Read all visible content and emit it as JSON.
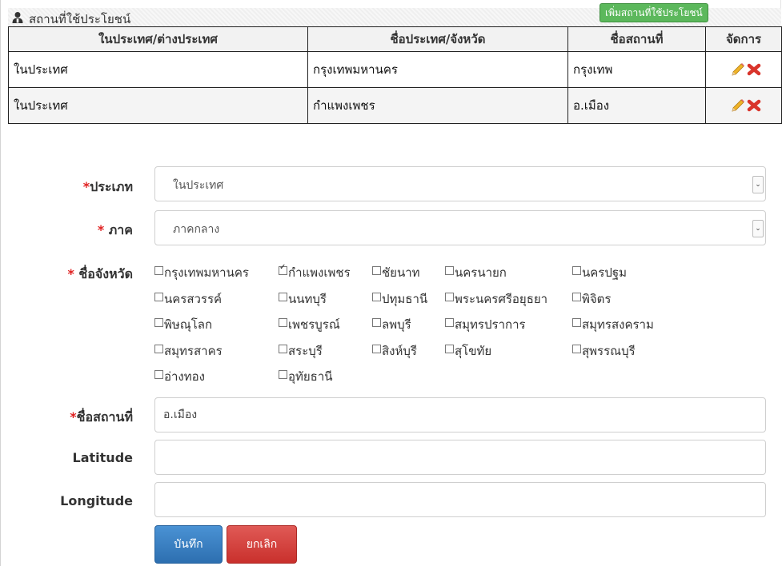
{
  "header": {
    "icon": "user-pin-icon",
    "title": "สถานที่ใช้ประโยชน์",
    "add_button": "เพิ่มสถานที่ใช้ประโยชน์"
  },
  "table": {
    "columns": [
      "ในประเทศ/ต่างประเทศ",
      "ชื่อประเทศ/จังหวัด",
      "ชื่อสถานที่",
      "จัดการ"
    ],
    "rows": [
      {
        "scope": "ในประเทศ",
        "province": "กรุงเทพมหานคร",
        "place": "กรุงเทพ"
      },
      {
        "scope": "ในประเทศ",
        "province": "กำแพงเพชร",
        "place": "อ.เมือง"
      }
    ],
    "action_icons": [
      "edit-pencil-icon",
      "delete-x-icon"
    ]
  },
  "form": {
    "required_mark": "*",
    "type_label": "ประเภท",
    "type_value": "ในประเทศ",
    "region_label": " ภาค",
    "region_value": "ภาคกลาง",
    "province_label": " ชื่อจังหวัด",
    "provinces": [
      {
        "name": "กรุงเทพมหานคร",
        "checked": false
      },
      {
        "name": "กำแพงเพชร",
        "checked": true
      },
      {
        "name": "ชัยนาท",
        "checked": false
      },
      {
        "name": "นครนายก",
        "checked": false
      },
      {
        "name": "นครปฐม",
        "checked": false
      },
      {
        "name": "นครสวรรค์",
        "checked": false
      },
      {
        "name": "นนทบุรี",
        "checked": false
      },
      {
        "name": "ปทุมธานี",
        "checked": false
      },
      {
        "name": "พระนครศรีอยุธยา",
        "checked": false
      },
      {
        "name": "พิจิตร",
        "checked": false
      },
      {
        "name": "พิษณุโลก",
        "checked": false
      },
      {
        "name": "เพชรบูรณ์",
        "checked": false
      },
      {
        "name": "ลพบุรี",
        "checked": false
      },
      {
        "name": "สมุทรปราการ",
        "checked": false
      },
      {
        "name": "สมุทรสงคราม",
        "checked": false
      },
      {
        "name": "สมุทรสาคร",
        "checked": false
      },
      {
        "name": "สระบุรี",
        "checked": false
      },
      {
        "name": "สิงห์บุรี",
        "checked": false
      },
      {
        "name": "สุโขทัย",
        "checked": false
      },
      {
        "name": "สุพรรณบุรี",
        "checked": false
      },
      {
        "name": "อ่างทอง",
        "checked": false
      },
      {
        "name": "อุทัยธานี",
        "checked": false
      }
    ],
    "place_label": "ชื่อสถานที่",
    "place_value": "อ.เมือง",
    "latitude_label": "Latitude",
    "latitude_value": "",
    "longitude_label": "Longitude",
    "longitude_value": "",
    "save_button": "บันทึก",
    "cancel_button": "ยกเลิก"
  },
  "colors": {
    "add_button": "#5cb85c",
    "save_button": "#337ab7",
    "cancel_button": "#d9534f",
    "required": "#e02020",
    "delete_icon": "#d9342b",
    "edit_icon": "#e8a317"
  }
}
